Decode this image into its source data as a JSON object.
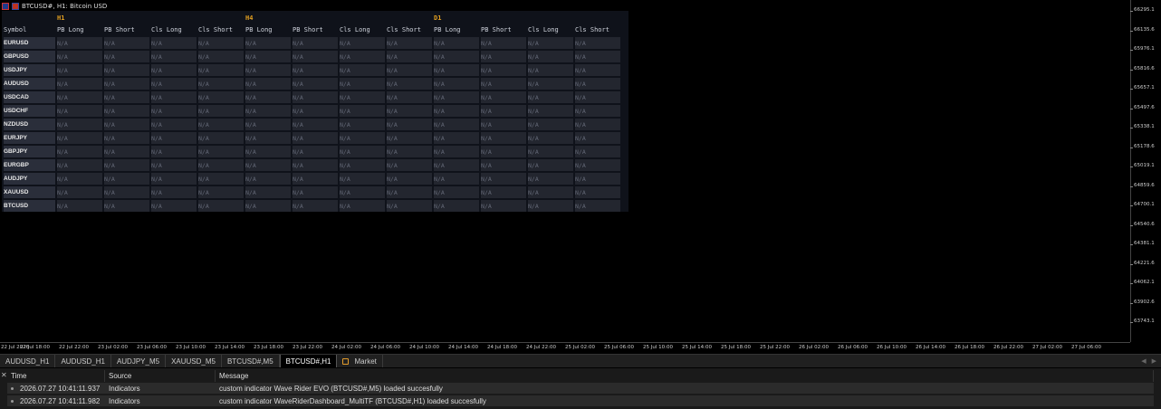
{
  "window": {
    "title": "BTCUSD#, H1: Bitcoin USD"
  },
  "dashboard": {
    "timeframes": [
      "H1",
      "H4",
      "D1"
    ],
    "symbol_header": "Symbol",
    "columns": [
      "PB Long",
      "PB Short",
      "Cls Long",
      "Cls Short"
    ],
    "symbols": [
      "EURUSD",
      "GBPUSD",
      "USDJPY",
      "AUDUSD",
      "USDCAD",
      "USDCHF",
      "NZDUSD",
      "EURJPY",
      "GBPJPY",
      "EURGBP",
      "AUDJPY",
      "XAUUSD",
      "BTCUSD"
    ],
    "cell_value": "N/A"
  },
  "price_scale": [
    "66295.1",
    "66135.6",
    "65976.1",
    "65816.6",
    "65657.1",
    "65497.6",
    "65338.1",
    "65178.6",
    "65019.1",
    "64859.6",
    "64700.1",
    "64540.6",
    "64381.1",
    "64221.6",
    "64062.1",
    "63902.6",
    "63743.1"
  ],
  "time_axis": [
    "22 Jul 2026",
    "22 Jul 18:00",
    "22 Jul 22:00",
    "23 Jul 02:00",
    "23 Jul 06:00",
    "23 Jul 10:00",
    "23 Jul 14:00",
    "23 Jul 18:00",
    "23 Jul 22:00",
    "24 Jul 02:00",
    "24 Jul 06:00",
    "24 Jul 10:00",
    "24 Jul 14:00",
    "24 Jul 18:00",
    "24 Jul 22:00",
    "25 Jul 02:00",
    "25 Jul 06:00",
    "25 Jul 10:00",
    "25 Jul 14:00",
    "25 Jul 18:00",
    "25 Jul 22:00",
    "26 Jul 02:00",
    "26 Jul 06:00",
    "26 Jul 10:00",
    "26 Jul 14:00",
    "26 Jul 18:00",
    "26 Jul 22:00",
    "27 Jul 02:00",
    "27 Jul 06:00"
  ],
  "tabs": [
    {
      "label": "AUDUSD_H1",
      "active": false
    },
    {
      "label": "AUDUSD_H1",
      "active": false
    },
    {
      "label": "AUDJPY_M5",
      "active": false
    },
    {
      "label": "XAUUSD_M5",
      "active": false
    },
    {
      "label": "BTCUSD#,M5",
      "active": false
    },
    {
      "label": "BTCUSD#,H1",
      "active": true
    },
    {
      "label": "Market",
      "active": false,
      "icon": "market-lock-icon"
    }
  ],
  "journal": {
    "columns": [
      "Time",
      "Source",
      "Message"
    ],
    "rows": [
      {
        "time": "2026.07.27 10:41:11.937",
        "source": "Indicators",
        "message": "custom indicator Wave Rider EVO (BTCUSD#,M5) loaded succesfully"
      },
      {
        "time": "2026.07.27 10:41:11.982",
        "source": "Indicators",
        "message": "custom indicator WaveRiderDashboard_MultiTF (BTCUSD#,H1) loaded succesfully"
      }
    ]
  }
}
